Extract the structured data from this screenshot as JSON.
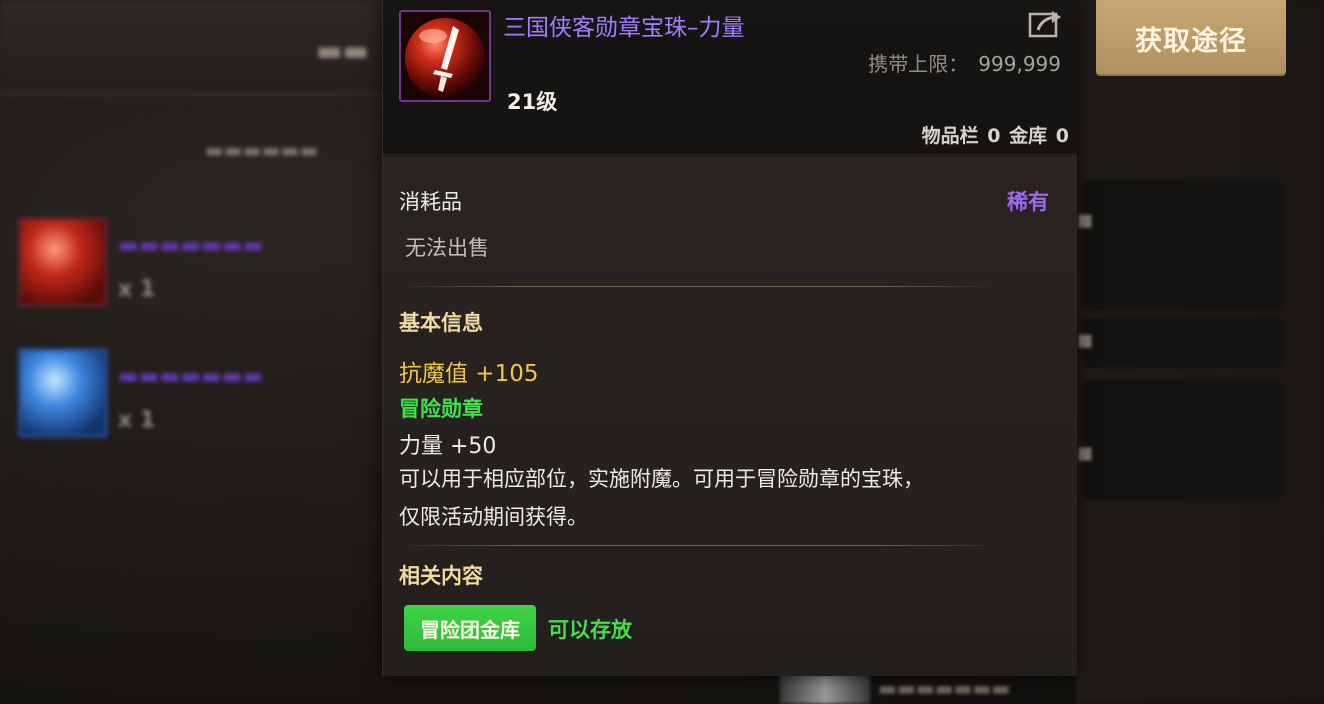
{
  "tooltip": {
    "item_name": "三国侠客勋章宝珠–力量",
    "carry_limit_label": "携带上限：",
    "carry_limit_value": "999,999",
    "level": "21级",
    "inventory_label": "物品栏",
    "inventory_count": "0",
    "vault_label": "金库",
    "vault_count": "0",
    "type": "消耗品",
    "rarity": "稀有",
    "sell_status": "无法出售",
    "basic_info_title": "基本信息",
    "magic_resist": "抗魔值 +105",
    "medal_type": "冒险勋章",
    "strength": "力量 +50",
    "description_line1": "可以用于相应部位，实施附魔。可用于冒险勋章的宝珠，",
    "description_line2": "仅限活动期间获得。",
    "related_title": "相关内容",
    "guild_vault_tag": "冒险团金库",
    "storable": "可以存放"
  },
  "acquire_button": {
    "label": "获取途径"
  },
  "colors": {
    "rare_purple": "#a57bff",
    "gold_stat": "#f3c649",
    "green": "#3ee34b",
    "button_gold": "#c7a873"
  }
}
